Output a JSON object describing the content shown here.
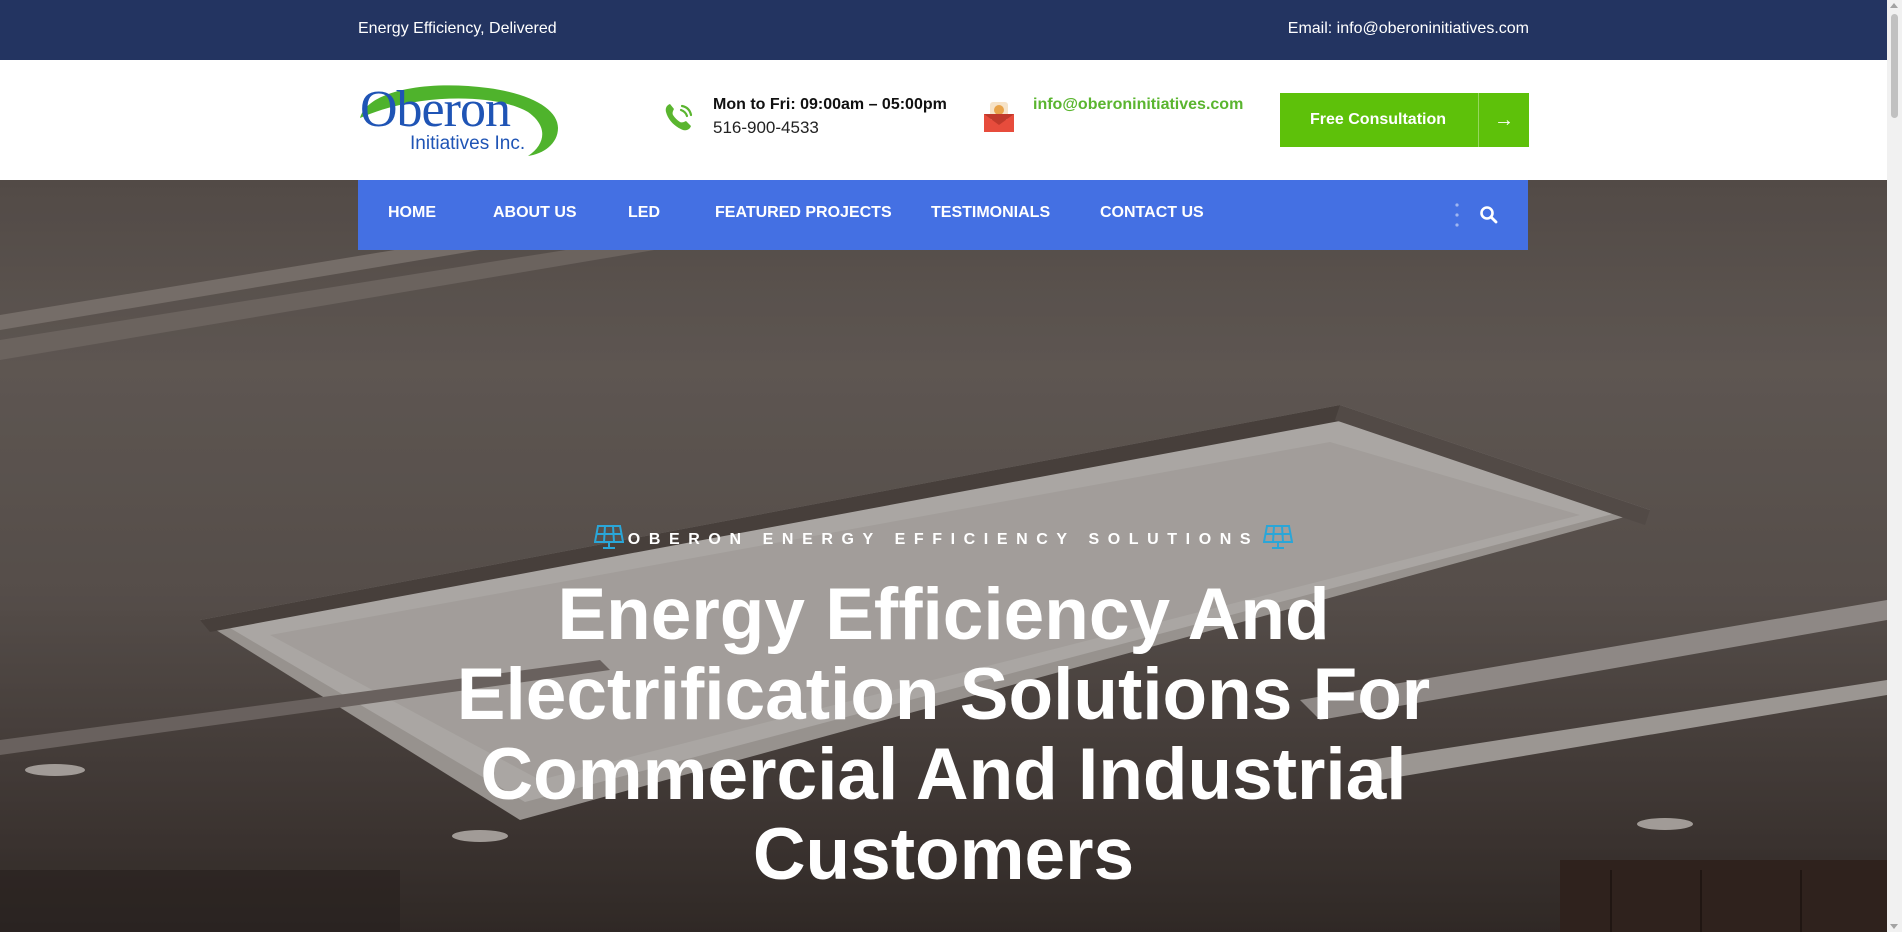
{
  "topbar": {
    "tagline": "Energy Efficiency, Delivered",
    "email": "Email: info@oberoninitiatives.com",
    "background": "#233461"
  },
  "header": {
    "logo": {
      "name": "Oberon",
      "subtitle": "Initiatives Inc."
    },
    "phone": {
      "hours": "Mon to Fri: 09:00am – 05:00pm",
      "number": "516-900-4533",
      "icon": "phone-icon"
    },
    "mail": {
      "address": "info@oberoninitiatives.com",
      "icon": "envelope-icon"
    },
    "cta": {
      "label": "Free Consultation",
      "icon": "arrow-right-icon",
      "color": "#5ec10a"
    }
  },
  "nav": {
    "background": "#4470e3",
    "items": [
      {
        "label": "Home"
      },
      {
        "label": "About Us"
      },
      {
        "label": "LED"
      },
      {
        "label": "Featured Projects"
      },
      {
        "label": "Testimonials"
      },
      {
        "label": "Contact Us"
      }
    ],
    "icons": [
      "vertical-dots-icon",
      "search-icon"
    ]
  },
  "hero": {
    "eyebrow": "OBERON ENERGY EFFICIENCY SOLUTIONS",
    "eyebrow_icon": "solar-panel-icon",
    "headline_lines": [
      "Energy Efficiency And",
      "Electrification Solutions For",
      "Commercial And Industrial",
      "Customers"
    ]
  }
}
